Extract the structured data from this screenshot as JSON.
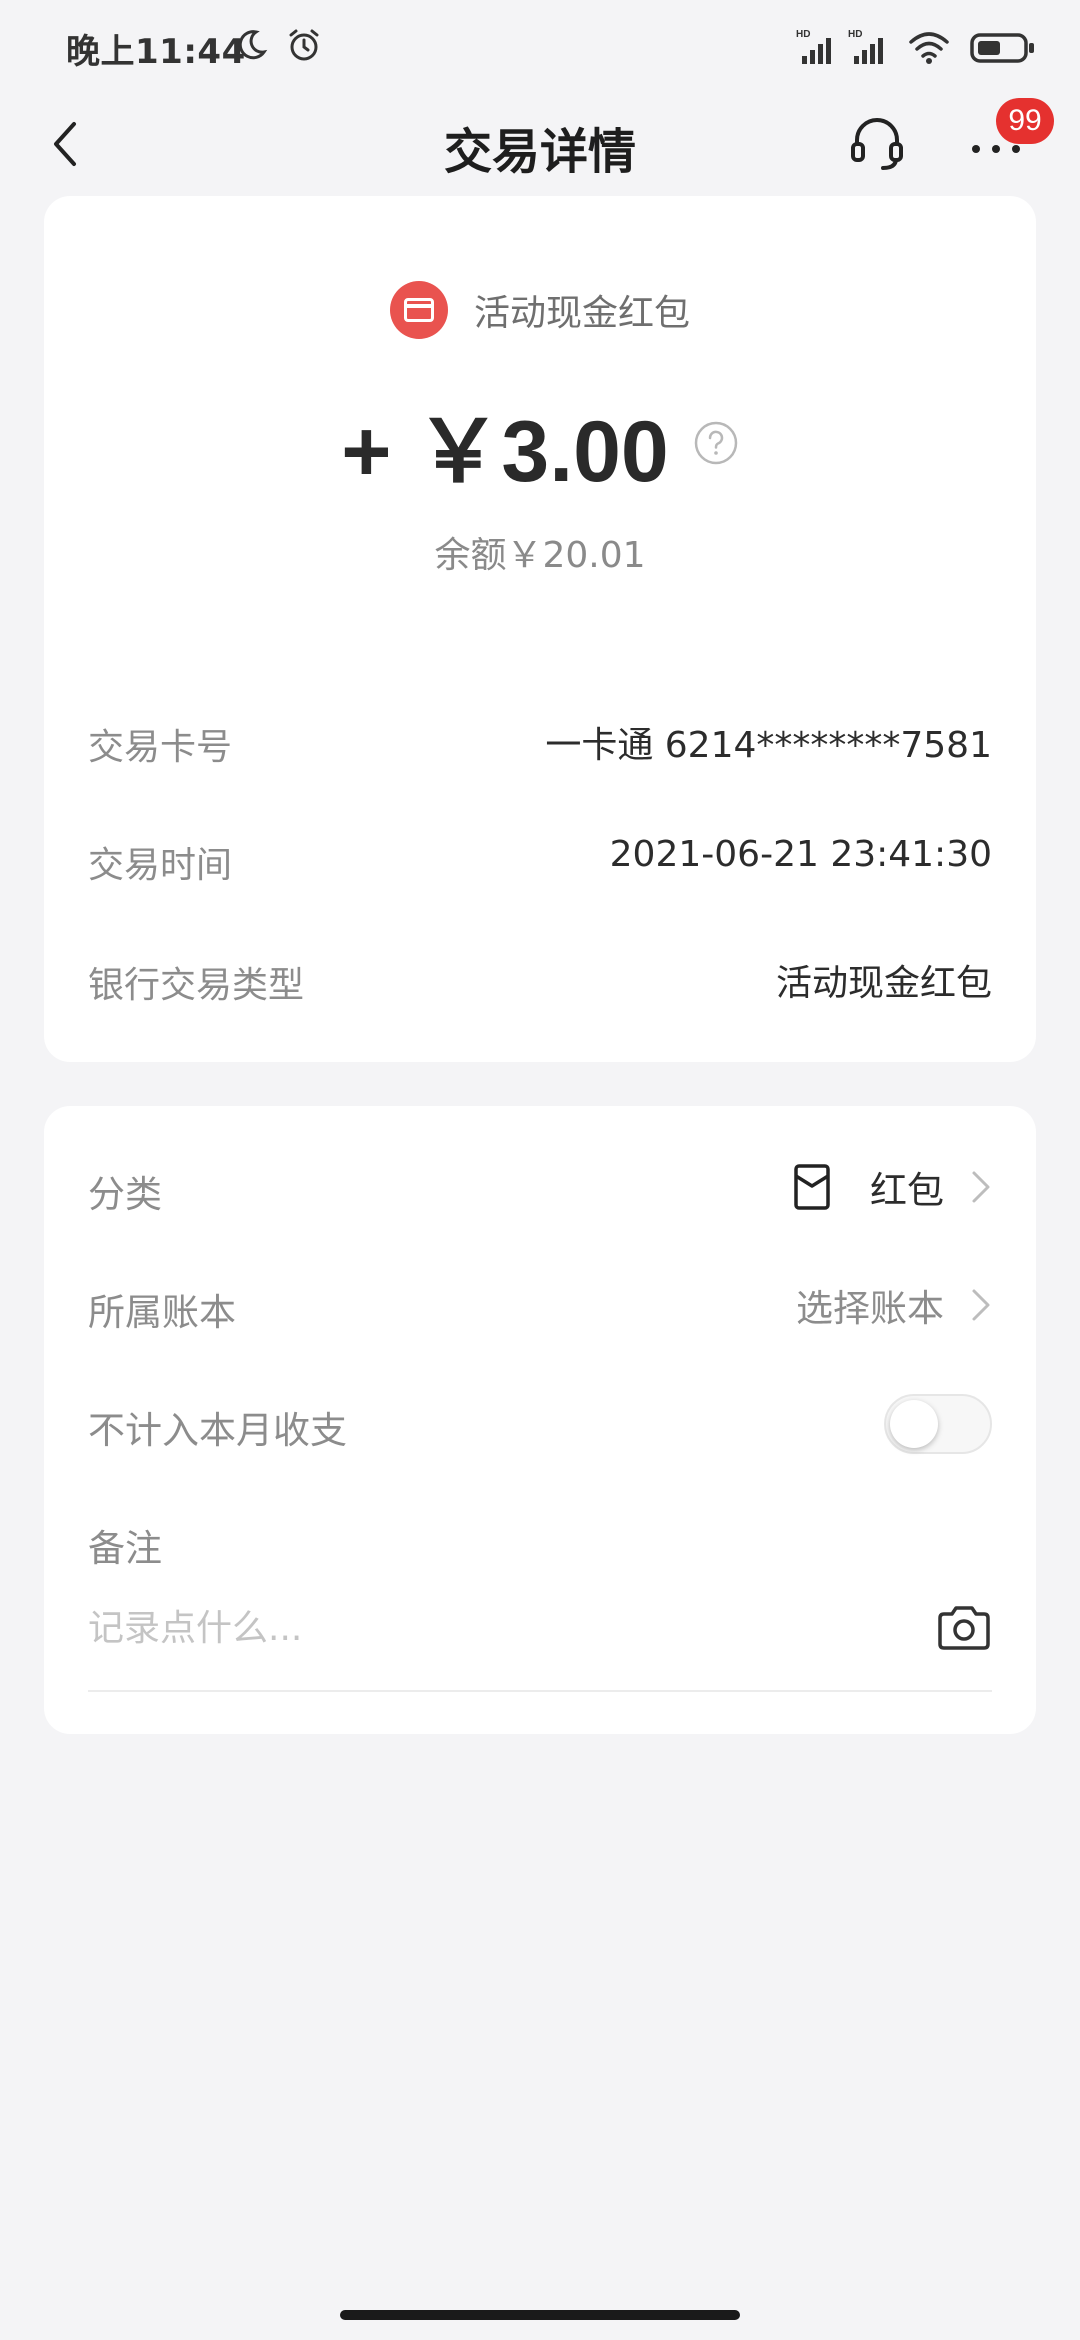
{
  "status_bar": {
    "time": "晚上11:44",
    "icons": [
      "moon-icon",
      "alarm-icon",
      "hd-signal-icon",
      "hd-signal-icon",
      "wifi-icon",
      "battery-icon"
    ]
  },
  "nav": {
    "title": "交易详情",
    "back_icon": "chevron-left-icon",
    "service_icon": "headset-icon",
    "more_icon": "more-dots-icon",
    "badge_count": "99"
  },
  "transaction": {
    "source_icon": "red-packet-card-icon",
    "source_label": "活动现金红包",
    "amount": "+ ￥3.00",
    "help_icon": "question-circle-icon",
    "balance": "余额￥20.01"
  },
  "details": [
    {
      "label": "交易卡号",
      "value": "一卡通 6214********7581"
    },
    {
      "label": "交易时间",
      "value": "2021-06-21 23:41:30"
    },
    {
      "label": "银行交易类型",
      "value": "活动现金红包"
    }
  ],
  "settings": {
    "category": {
      "label": "分类",
      "value": "红包",
      "icon": "red-envelope-icon"
    },
    "account_book": {
      "label": "所属账本",
      "value": "选择账本"
    },
    "exclude": {
      "label": "不计入本月收支",
      "enabled": false
    }
  },
  "memo": {
    "label": "备注",
    "placeholder": "记录点什么...",
    "value": "",
    "camera_icon": "camera-icon"
  },
  "colors": {
    "accent_red": "#e5312f",
    "source_icon_bg": "#e9534f",
    "page_bg": "#f4f4f6"
  }
}
